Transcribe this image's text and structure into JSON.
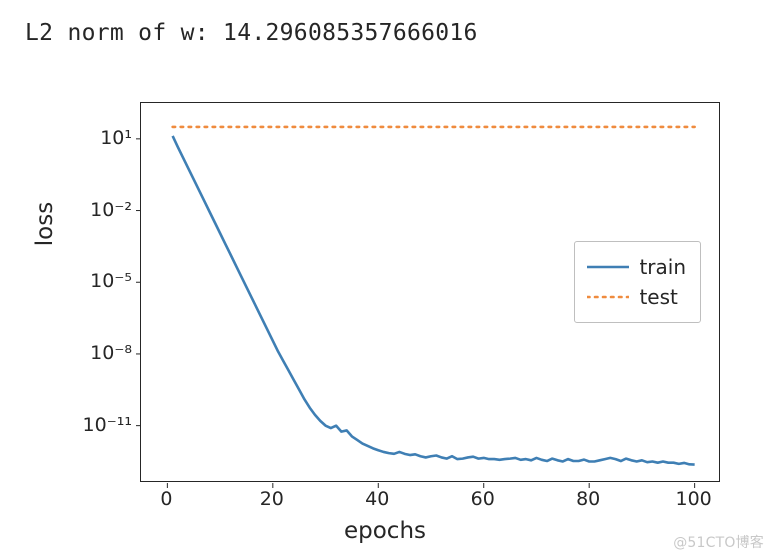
{
  "title": "L2 norm of w: 14.296085357666016",
  "watermark": "@51CTO博客",
  "chart_data": {
    "type": "line",
    "xlabel": "epochs",
    "ylabel": "loss",
    "xlim": [
      -5,
      105
    ],
    "ylim_log10": [
      -13.4,
      2.5
    ],
    "yscale": "log",
    "xticks": [
      0,
      20,
      40,
      60,
      80,
      100
    ],
    "ytick_exponents": [
      1,
      -2,
      -5,
      -8,
      -11
    ],
    "legend": {
      "entries": [
        "train",
        "test"
      ],
      "loc": "right"
    },
    "colors": {
      "train": "#3f7fb4",
      "test": "#ef8b3e"
    },
    "series": [
      {
        "name": "train",
        "style": "solid",
        "x": [
          1,
          2,
          3,
          4,
          5,
          6,
          7,
          8,
          9,
          10,
          11,
          12,
          13,
          14,
          15,
          16,
          17,
          18,
          19,
          20,
          21,
          22,
          23,
          24,
          25,
          26,
          27,
          28,
          29,
          30,
          31,
          32,
          33,
          34,
          35,
          36,
          37,
          38,
          39,
          40,
          41,
          42,
          43,
          44,
          45,
          46,
          47,
          48,
          49,
          50,
          51,
          52,
          53,
          54,
          55,
          56,
          57,
          58,
          59,
          60,
          61,
          62,
          63,
          64,
          65,
          66,
          67,
          68,
          69,
          70,
          71,
          72,
          73,
          74,
          75,
          76,
          77,
          78,
          79,
          80,
          81,
          82,
          83,
          84,
          85,
          86,
          87,
          88,
          89,
          90,
          91,
          92,
          93,
          94,
          95,
          96,
          97,
          98,
          99,
          100
        ],
        "y_log10": [
          1.12,
          0.65,
          0.2,
          -0.25,
          -0.7,
          -1.15,
          -1.6,
          -2.05,
          -2.5,
          -2.95,
          -3.4,
          -3.85,
          -4.3,
          -4.75,
          -5.2,
          -5.65,
          -6.1,
          -6.55,
          -7.0,
          -7.45,
          -7.9,
          -8.3,
          -8.7,
          -9.1,
          -9.5,
          -9.9,
          -10.25,
          -10.55,
          -10.8,
          -11.0,
          -11.1,
          -11.0,
          -11.25,
          -11.2,
          -11.45,
          -11.6,
          -11.75,
          -11.85,
          -11.95,
          -12.03,
          -12.1,
          -12.15,
          -12.18,
          -12.1,
          -12.18,
          -12.23,
          -12.2,
          -12.28,
          -12.33,
          -12.28,
          -12.25,
          -12.33,
          -12.38,
          -12.28,
          -12.4,
          -12.38,
          -12.33,
          -12.3,
          -12.38,
          -12.35,
          -12.4,
          -12.4,
          -12.43,
          -12.4,
          -12.38,
          -12.35,
          -12.43,
          -12.4,
          -12.45,
          -12.35,
          -12.43,
          -12.48,
          -12.38,
          -12.45,
          -12.5,
          -12.4,
          -12.48,
          -12.48,
          -12.42,
          -12.5,
          -12.5,
          -12.45,
          -12.4,
          -12.35,
          -12.4,
          -12.48,
          -12.38,
          -12.45,
          -12.5,
          -12.45,
          -12.53,
          -12.5,
          -12.55,
          -12.5,
          -12.55,
          -12.55,
          -12.6,
          -12.56,
          -12.62,
          -12.63
        ]
      },
      {
        "name": "test",
        "style": "dotted",
        "x": [
          1,
          100
        ],
        "y_log10": [
          1.5,
          1.5
        ]
      }
    ]
  }
}
